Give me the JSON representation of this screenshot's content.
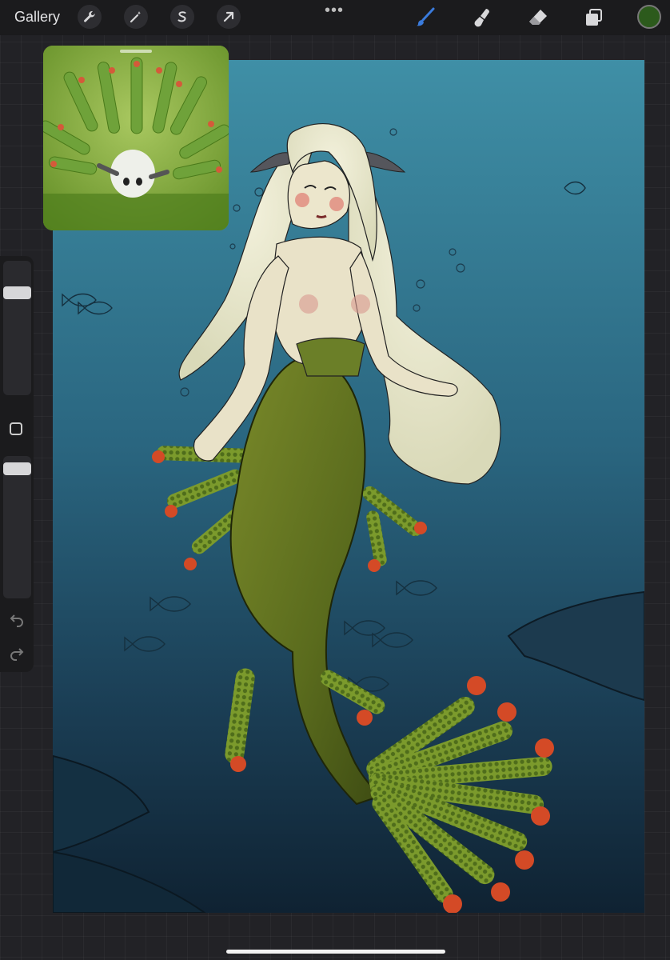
{
  "toolbar": {
    "gallery_label": "Gallery",
    "left_tools": [
      "wrench-icon",
      "magic-wand-icon",
      "selection-icon",
      "transform-arrow-icon"
    ],
    "more_label": "•••",
    "right_tools": [
      "brush-icon",
      "smudge-icon",
      "eraser-icon",
      "layers-icon"
    ],
    "active_tool": "brush-icon",
    "active_color": "#2c5a1c"
  },
  "sidebar": {
    "brush_size_level": 0.15,
    "opacity_level": 0.05,
    "undo_icon": "undo-icon",
    "redo_icon": "redo-icon"
  },
  "colors": {
    "background": "#222226",
    "accent": "#3a7bdc",
    "water_top": "#3e8ca3",
    "water_bottom": "#122536",
    "tail_green": "#5f6f1f",
    "fin_tip_red": "#d44a26"
  },
  "reference": {
    "subject": "leaf-sheep-sea-slug-photo"
  }
}
